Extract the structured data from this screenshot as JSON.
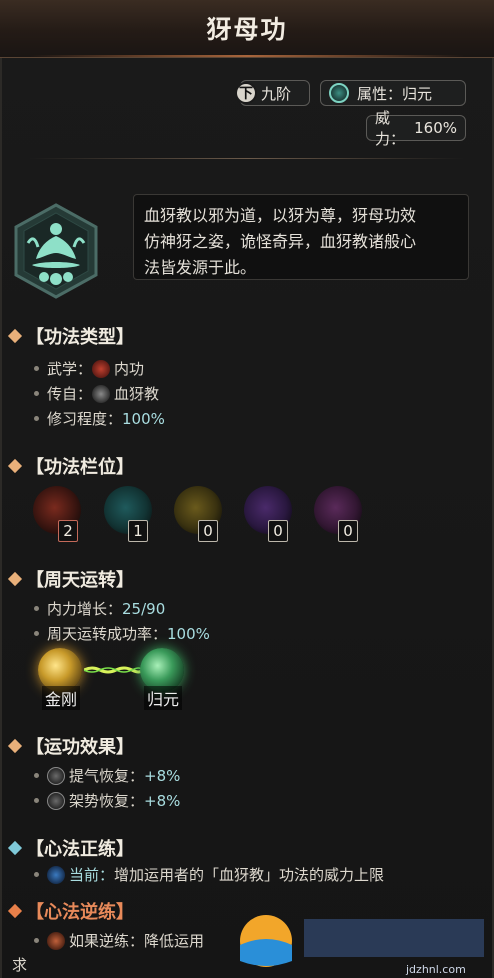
{
  "title": "犽母功",
  "grade": {
    "icon": "下",
    "label": "九阶"
  },
  "attribute": {
    "label": "属性：",
    "value": "归元"
  },
  "power": {
    "label": "威力：",
    "value": "160%"
  },
  "description_line1": "血犽教以邪为道，以犽为尊，犽母功效",
  "description_line2": "仿神犽之姿，诡怪奇异，血犽教诸般心",
  "description_line3": "法皆发源于此。",
  "sections": {
    "type": {
      "title": "【功法类型】",
      "martial_label": "武学：",
      "martial_value": "内功",
      "origin_label": "传自：",
      "origin_value": "血犽教",
      "mastery_label": "修习程度：",
      "mastery_value": "100%"
    },
    "slots": {
      "title": "【功法栏位】",
      "values": [
        "2",
        "1",
        "0",
        "0",
        "0"
      ]
    },
    "circulation": {
      "title": "【周天运转】",
      "growth_label": "内力增长：",
      "growth_value": "25/90",
      "success_label": "周天运转成功率：",
      "success_value": "100%",
      "from": "金刚",
      "to": "归元"
    },
    "effects": {
      "title": "【运功效果】",
      "e1_label": "提气恢复：",
      "e1_value": "+8%",
      "e2_label": "架势恢复：",
      "e2_value": "+8%"
    },
    "forward": {
      "title": "【心法正练】",
      "current_label": "当前：",
      "current_text": "增加运用者的「血犽教」功法的威力上限"
    },
    "reverse": {
      "title": "【心法逆练】",
      "text_start": "如果逆练：降低运用",
      "text_end": "求"
    }
  },
  "watermark_text": "jdzhnl.com"
}
